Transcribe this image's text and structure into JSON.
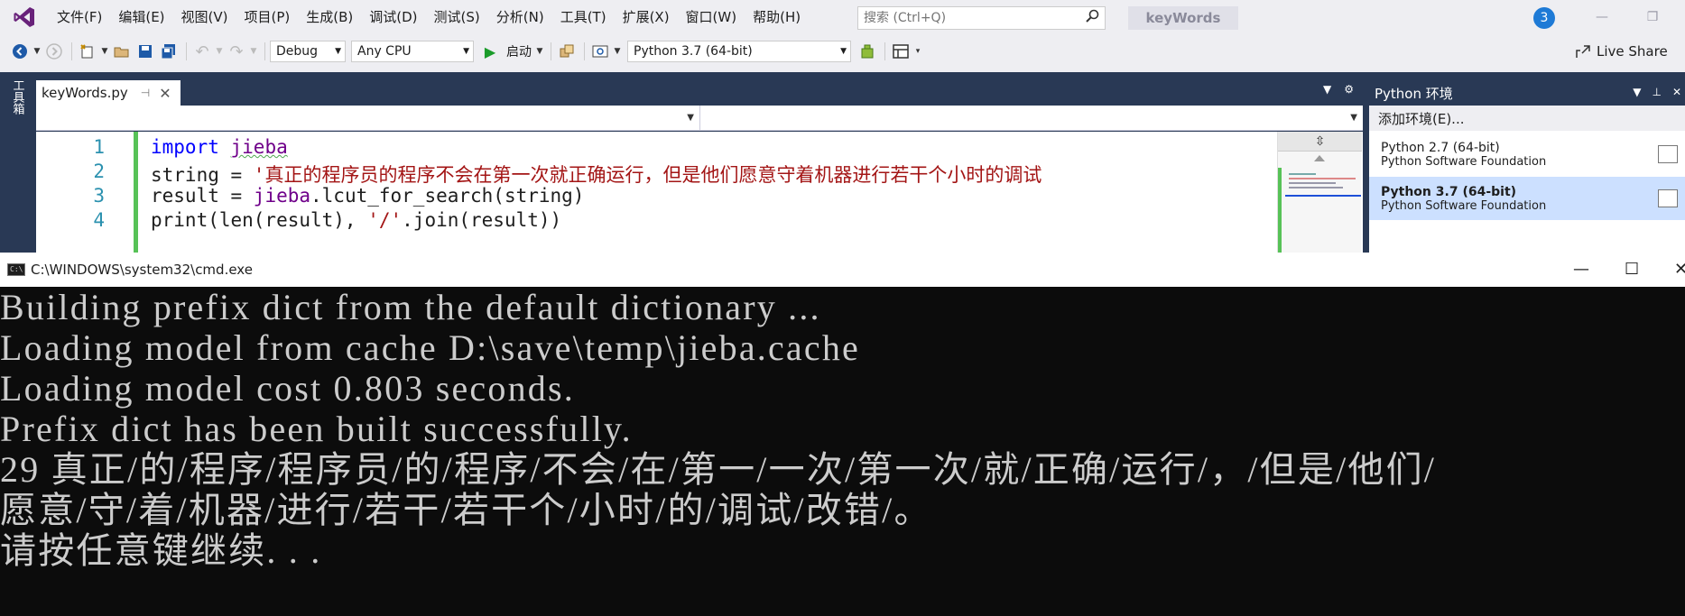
{
  "menubar": {
    "logo_icon": "visual-studio-logo-icon",
    "items": [
      "文件(F)",
      "编辑(E)",
      "视图(V)",
      "项目(P)",
      "生成(B)",
      "调试(D)",
      "测试(S)",
      "分析(N)",
      "工具(T)",
      "扩展(X)",
      "窗口(W)",
      "帮助(H)"
    ],
    "search_placeholder": "搜索 (Ctrl+Q)",
    "solution_name": "keyWords",
    "notification_count": "3"
  },
  "toolbar": {
    "configuration": "Debug",
    "platform": "Any CPU",
    "start_label": "启动",
    "python_env": "Python 3.7 (64-bit)",
    "live_share": "Live Share"
  },
  "toolbox_label": "工具箱",
  "editor": {
    "tab_title": "keyWords.py",
    "line_numbers": [
      "1",
      "2",
      "3",
      "4"
    ],
    "lines": {
      "l1_kw": "import",
      "l1_mod": "jieba",
      "l2_var": "string",
      "l2_op": " = ",
      "l2_str": "'真正的程序员的程序不会在第一次就正确运行，但是他们愿意守着机器进行若干个小时的调试",
      "l3_var": "result",
      "l3_op": " = ",
      "l3_mod": "jieba",
      "l3_call": ".lcut_for_search(string)",
      "l4_a": "print(len(result), ",
      "l4_str": "'/'",
      "l4_b": ".join(result))"
    }
  },
  "python_panel": {
    "title": "Python 环境",
    "add_env": "添加环境(E)...",
    "envs": [
      {
        "name": "Python 2.7 (64-bit)",
        "publisher": "Python Software Foundation",
        "selected": false
      },
      {
        "name": "Python 3.7 (64-bit)",
        "publisher": "Python Software Foundation",
        "selected": true
      }
    ]
  },
  "cmd": {
    "title": "C:\\WINDOWS\\system32\\cmd.exe",
    "lines": [
      "Building prefix dict from the default dictionary ...",
      "Loading model from cache D:\\save\\temp\\jieba.cache",
      "Loading model cost 0.803 seconds.",
      "Prefix dict has been built successfully.",
      "29 真正/的/程序/程序员/的/程序/不会/在/第一/一次/第一次/就/正确/运行/，/但是/他们/",
      "愿意/守/着/机器/进行/若干/若干个/小时/的/调试/改错/。",
      "请按任意键继续. . ."
    ]
  }
}
